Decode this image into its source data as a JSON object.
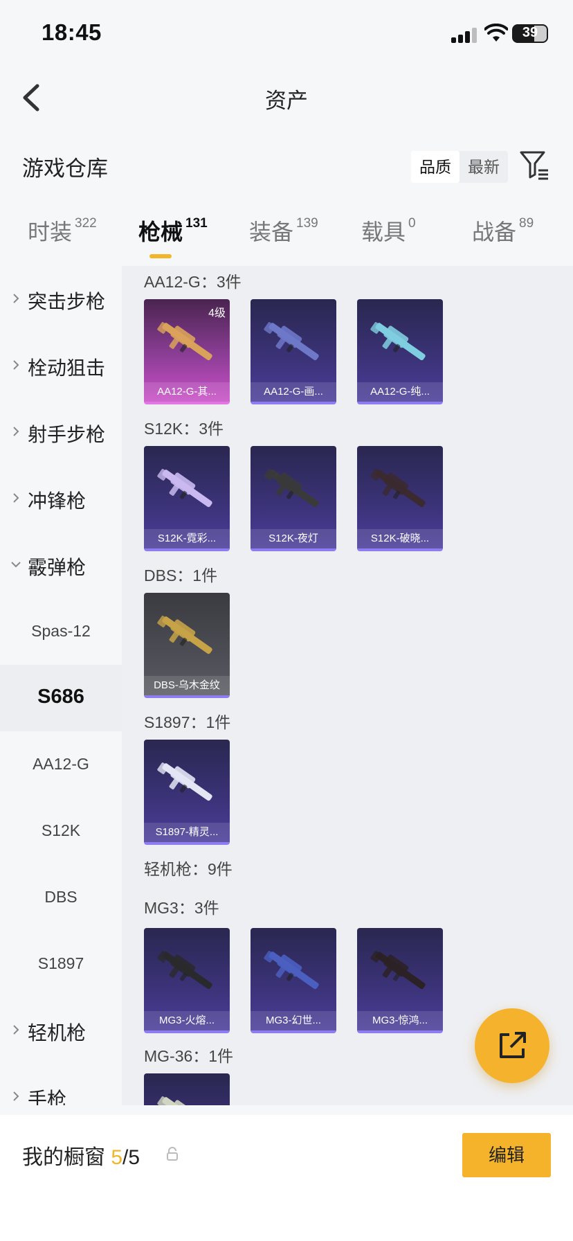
{
  "status": {
    "time": "18:45",
    "battery": "39"
  },
  "nav": {
    "title": "资产"
  },
  "warehouse": {
    "title": "游戏仓库",
    "sort_options": [
      "品质",
      "最新"
    ]
  },
  "tabs": [
    {
      "label": "时装",
      "count": "322"
    },
    {
      "label": "枪械",
      "count": "131"
    },
    {
      "label": "装备",
      "count": "139"
    },
    {
      "label": "载具",
      "count": "0"
    },
    {
      "label": "战备",
      "count": "89"
    }
  ],
  "sidebar": {
    "items": [
      {
        "label": "突击步枪"
      },
      {
        "label": "栓动狙击"
      },
      {
        "label": "射手步枪"
      },
      {
        "label": "冲锋枪"
      },
      {
        "label": "霰弹枪"
      },
      {
        "label": "Spas-12"
      },
      {
        "label": "S686"
      },
      {
        "label": "AA12-G"
      },
      {
        "label": "S12K"
      },
      {
        "label": "DBS"
      },
      {
        "label": "S1897"
      },
      {
        "label": "轻机枪"
      },
      {
        "label": "手枪"
      }
    ]
  },
  "groups": [
    {
      "label": "AA12-G：3件",
      "items": [
        {
          "name": "AA12-G-其...",
          "badge": "4级",
          "rarity": "pink",
          "gun_color": "#d9a25a"
        },
        {
          "name": "AA12-G-画...",
          "rarity": "purple",
          "gun_color": "#6d78c9"
        },
        {
          "name": "AA12-G-纯...",
          "rarity": "purple",
          "gun_color": "#7fcde0"
        }
      ]
    },
    {
      "label": "S12K：3件",
      "items": [
        {
          "name": "S12K-霓彩...",
          "rarity": "purple",
          "gun_color": "#c9b9f0"
        },
        {
          "name": "S12K-夜灯",
          "rarity": "purple",
          "gun_color": "#3a3a3a"
        },
        {
          "name": "S12K-破晓...",
          "rarity": "purple",
          "gun_color": "#3b2a30"
        }
      ]
    },
    {
      "label": "DBS：1件",
      "items": [
        {
          "name": "DBS-乌木金纹",
          "rarity": "gray",
          "gun_color": "#c7a347"
        }
      ]
    },
    {
      "label": "S1897：1件",
      "items": [
        {
          "name": "S1897-精灵...",
          "rarity": "purple",
          "gun_color": "#e3e6f5"
        }
      ]
    },
    {
      "label": "轻机枪：9件",
      "items": []
    },
    {
      "label": "MG3：3件",
      "items": [
        {
          "name": "MG3-火熔...",
          "rarity": "purple",
          "gun_color": "#2a2a2e"
        },
        {
          "name": "MG3-幻世...",
          "rarity": "purple",
          "gun_color": "#4a5fc0"
        },
        {
          "name": "MG3-惊鸿...",
          "rarity": "purple",
          "gun_color": "#2c2226"
        }
      ]
    },
    {
      "label": "MG-36：1件",
      "items": [
        {
          "name": "",
          "rarity": "purple",
          "gun_color": "#d0d6c0"
        }
      ]
    }
  ],
  "bottom": {
    "showcase_label": "我的橱窗",
    "current": "5",
    "total": "/5",
    "edit_label": "编辑"
  },
  "colors": {
    "accent": "#f4b32b"
  }
}
